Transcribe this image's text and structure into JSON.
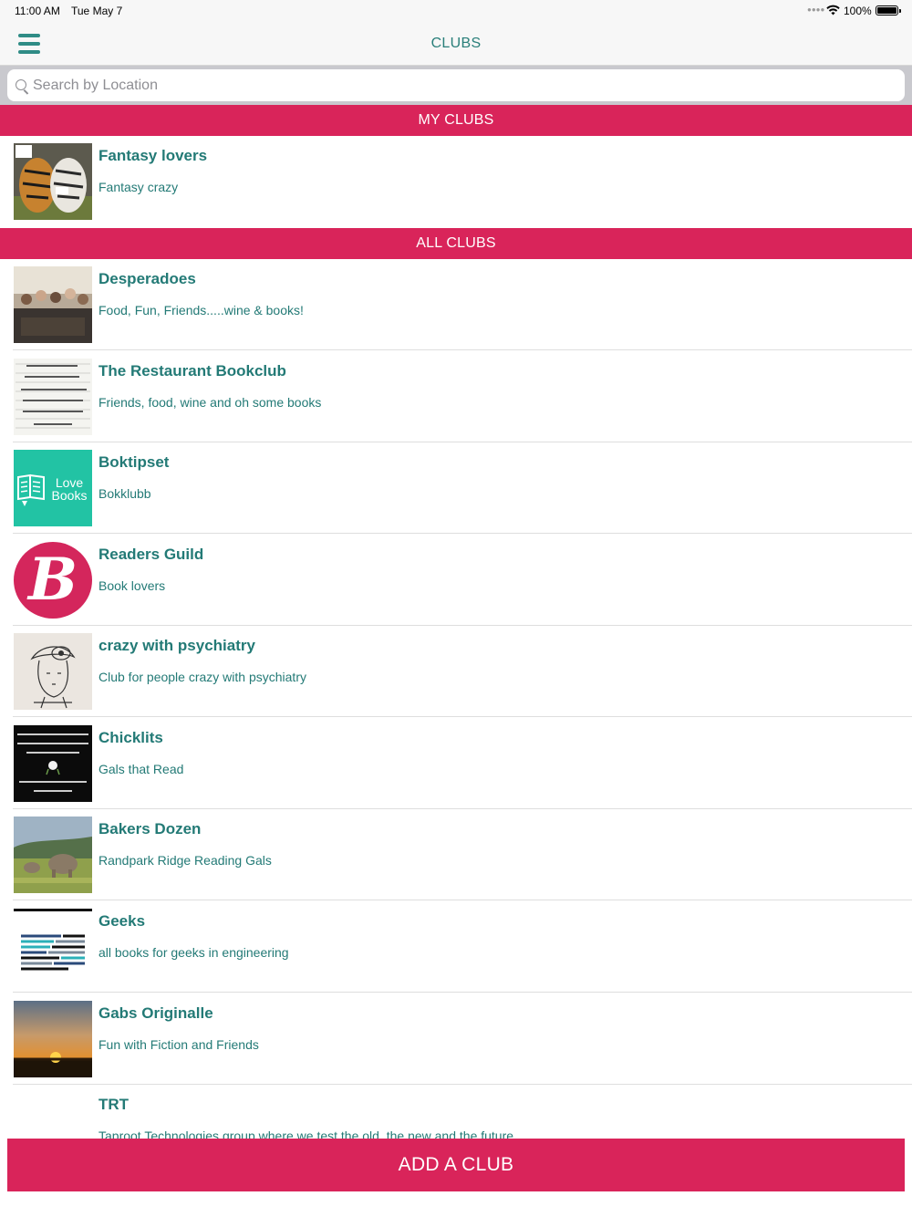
{
  "status_bar": {
    "time": "11:00 AM",
    "date": "Tue May 7",
    "battery": "100%"
  },
  "nav": {
    "title": "CLUBS",
    "menu_icon": "hamburger-menu-icon"
  },
  "search": {
    "placeholder": "Search by Location",
    "value": ""
  },
  "sections": {
    "my_clubs": "MY CLUBS",
    "all_clubs": "ALL CLUBS"
  },
  "my_clubs": [
    {
      "name": "Fantasy lovers",
      "description": "Fantasy crazy",
      "thumbnail": "tigers-photo"
    }
  ],
  "all_clubs": [
    {
      "name": "Desperadoes",
      "description": "Food, Fun, Friends.....wine & books!",
      "thumbnail": "group-photo"
    },
    {
      "name": "The Restaurant Bookclub",
      "description": "Friends, food, wine and oh some books",
      "thumbnail": "quote-text-image"
    },
    {
      "name": "Boktipset",
      "description": "Bokklubb",
      "thumbnail": "love-books-logo",
      "thumbnail_text": "Love Books"
    },
    {
      "name": "Readers Guild",
      "description": "Book lovers",
      "thumbnail": "letter-b-logo",
      "thumbnail_text": "B"
    },
    {
      "name": "crazy with psychiatry",
      "description": "Club for people crazy with psychiatry",
      "thumbnail": "sketch-drawing"
    },
    {
      "name": "Chicklits",
      "description": "Gals that Read",
      "thumbnail": "dog-quote-image"
    },
    {
      "name": "Bakers Dozen",
      "description": "Randpark Ridge Reading Gals",
      "thumbnail": "elephants-photo"
    },
    {
      "name": "Geeks",
      "description": "all books for geeks in engineering",
      "thumbnail": "word-cloud-image"
    },
    {
      "name": "Gabs Originalle",
      "description": "Fun with Fiction and Friends",
      "thumbnail": "sunset-photo"
    },
    {
      "name": "TRT",
      "description": "Taproot Technologies group where we test the old, the new and the future",
      "thumbnail": ""
    }
  ],
  "actions": {
    "add_club": "ADD A CLUB"
  },
  "colors": {
    "accent_pink": "#d9245a",
    "teal_text": "#237a76",
    "love_books_teal": "#22c3a4"
  }
}
